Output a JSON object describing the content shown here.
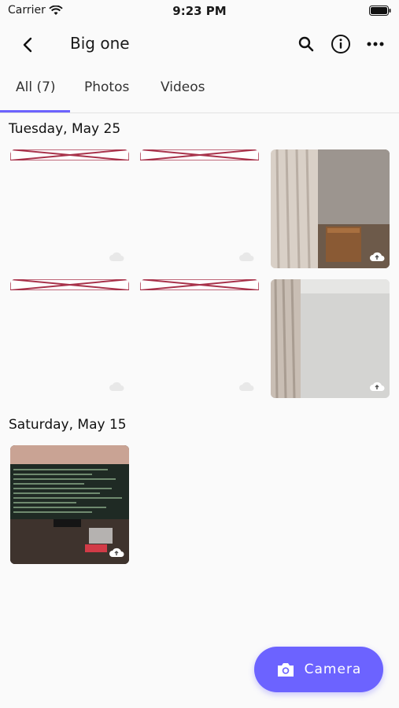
{
  "status_bar": {
    "carrier": "Carrier",
    "time": "9:23 PM"
  },
  "header": {
    "title": "Big one"
  },
  "tabs": [
    {
      "label": "All (7)",
      "active": true
    },
    {
      "label": "Photos",
      "active": false
    },
    {
      "label": "Videos",
      "active": false
    }
  ],
  "sections": [
    {
      "title": "Tuesday, May 25"
    },
    {
      "title": "Saturday, May 15"
    }
  ],
  "fab": {
    "label": "Camera"
  },
  "colors": {
    "accent": "#6c63ff",
    "banner_red": "#a8324a"
  },
  "icons": [
    "back-icon",
    "search-icon",
    "info-icon",
    "more-icon",
    "cloud-upload-icon",
    "camera-icon",
    "wifi-icon",
    "battery-icon"
  ]
}
